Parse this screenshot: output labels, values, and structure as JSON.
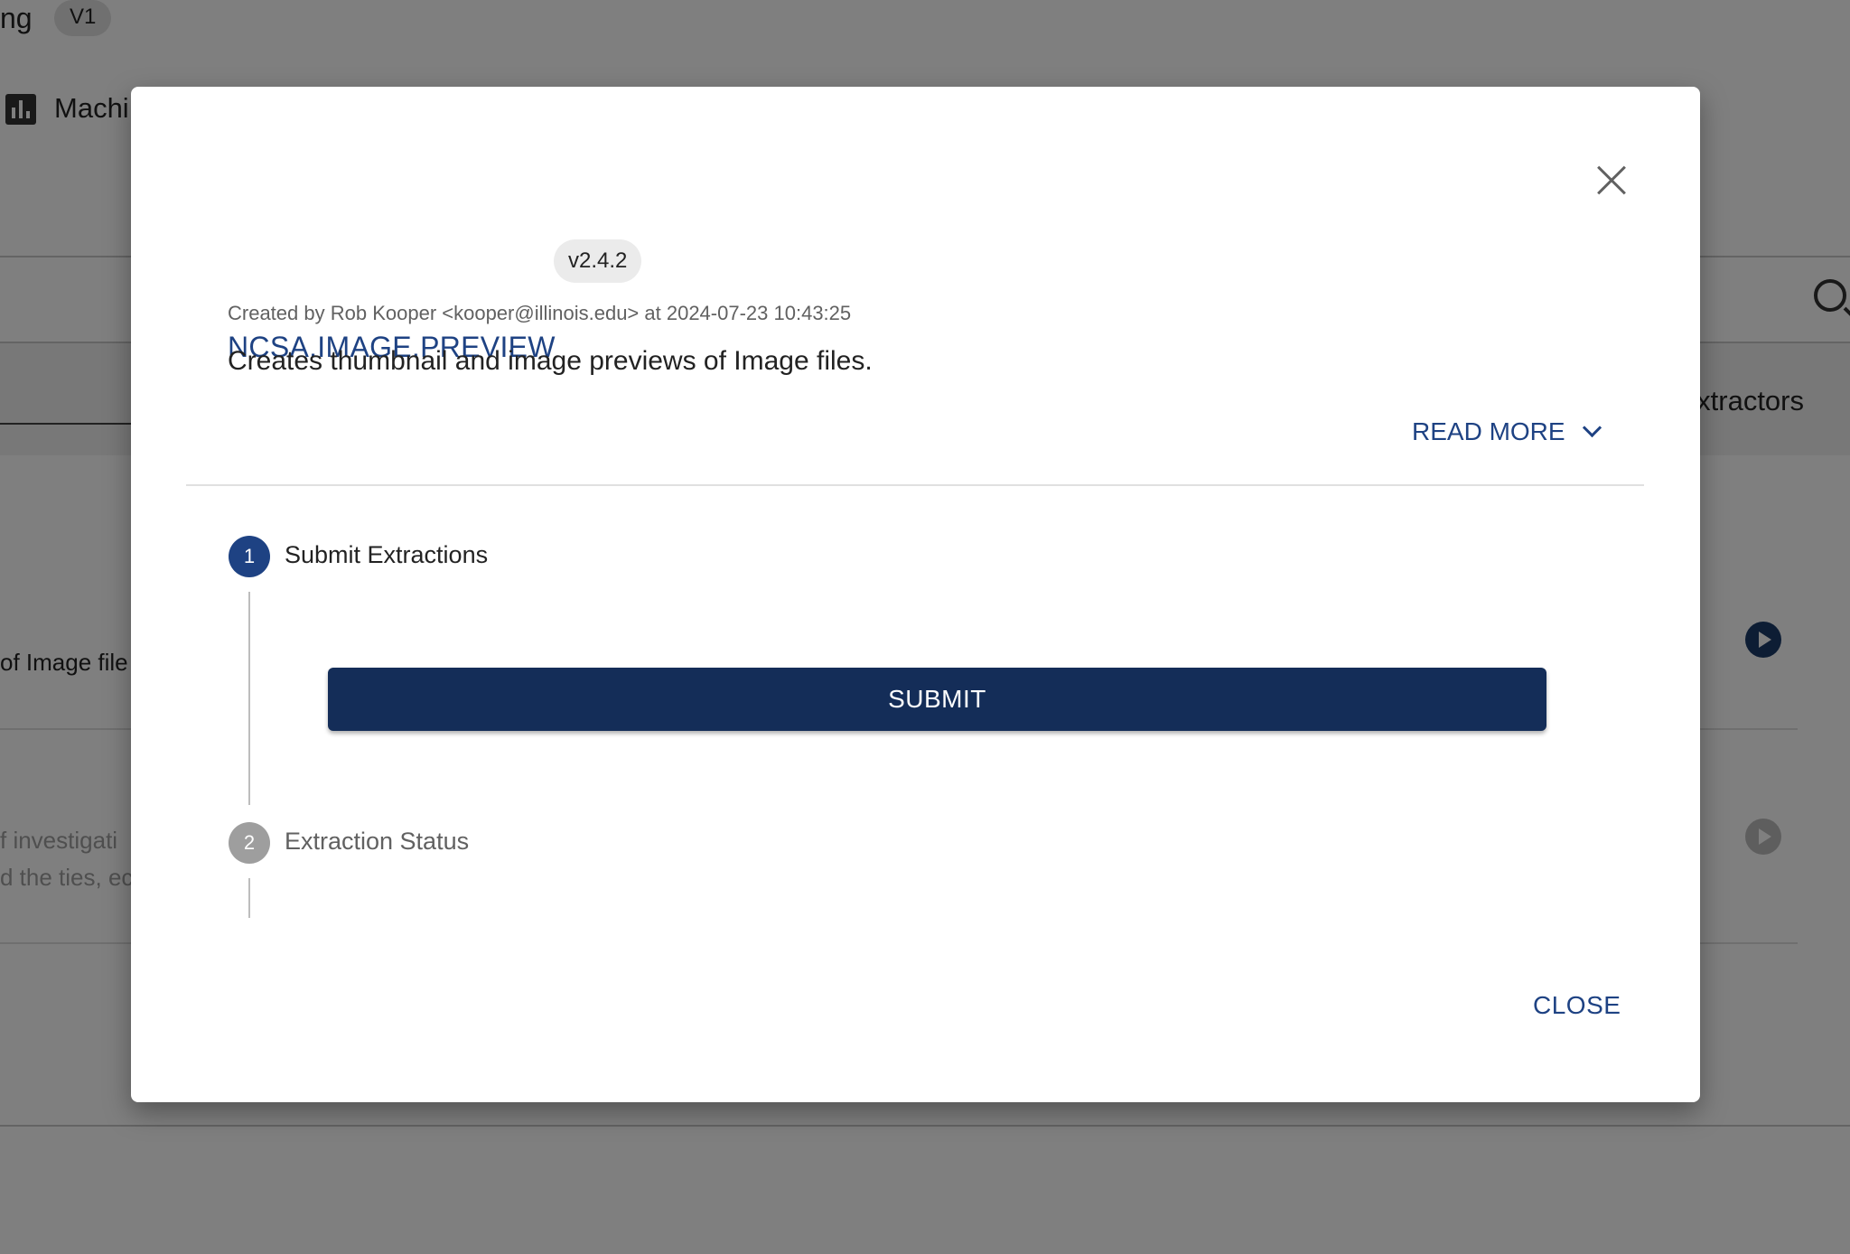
{
  "background": {
    "title_fragment": "ng",
    "version_chip": "V1",
    "nav_label_fragment": "Machi",
    "tab_label_fragment": "xtractors",
    "row1_text_fragment": "of Image file",
    "row2_line1_fragment": "f investigati",
    "row2_line2_fragment": "d the ties, ec"
  },
  "dialog": {
    "extractor_name": "NCSA.IMAGE.PREVIEW",
    "version": "v2.4.2",
    "created_by": "Created by Rob Kooper <kooper@illinois.edu> at 2024-07-23 10:43:25",
    "description": "Creates thumbnail and image previews of Image files.",
    "read_more_label": "READ MORE",
    "steps": [
      {
        "number": "1",
        "label": "Submit Extractions",
        "state": "active"
      },
      {
        "number": "2",
        "label": "Extraction Status",
        "state": "inactive"
      }
    ],
    "submit_label": "SUBMIT",
    "close_label": "CLOSE"
  },
  "colors": {
    "primary": "#1e4283",
    "submit_button": "#142d58",
    "inactive_step": "#9e9e9e",
    "overlay": "rgba(0,0,0,0.5)"
  }
}
